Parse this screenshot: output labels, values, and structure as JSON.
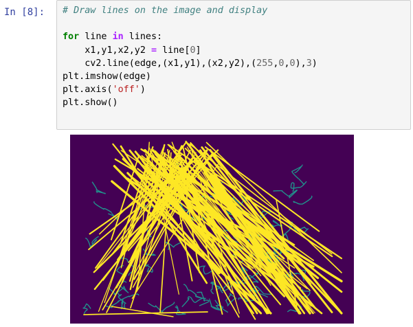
{
  "cell": {
    "prompt": "In [8]:",
    "code_lines": [
      [
        {
          "t": "# Draw lines on the image and display",
          "c": "tok-comment"
        }
      ],
      [],
      [
        {
          "t": "for",
          "c": "tok-kw"
        },
        {
          "t": " line "
        },
        {
          "t": "in",
          "c": "tok-op"
        },
        {
          "t": " lines:"
        }
      ],
      [
        {
          "t": "    x1,y1,x2,y2 "
        },
        {
          "t": "=",
          "c": "tok-op"
        },
        {
          "t": " line["
        },
        {
          "t": "0",
          "c": "tok-num"
        },
        {
          "t": "]"
        }
      ],
      [
        {
          "t": "    cv2.line(edge,(x1,y1),(x2,y2),("
        },
        {
          "t": "255",
          "c": "tok-num"
        },
        {
          "t": ","
        },
        {
          "t": "0",
          "c": "tok-num"
        },
        {
          "t": ","
        },
        {
          "t": "0",
          "c": "tok-num"
        },
        {
          "t": "),"
        },
        {
          "t": "3",
          "c": "tok-num"
        },
        {
          "t": ")"
        }
      ],
      [
        {
          "t": "plt.imshow(edge)"
        }
      ],
      [
        {
          "t": "plt.axis("
        },
        {
          "t": "'off'",
          "c": "tok-str"
        },
        {
          "t": ")"
        }
      ],
      [
        {
          "t": "plt.show()"
        }
      ]
    ]
  },
  "output": {
    "image_description_colors": {
      "background": "#440154",
      "lines": "#fde725",
      "edges": "#21918c"
    }
  }
}
